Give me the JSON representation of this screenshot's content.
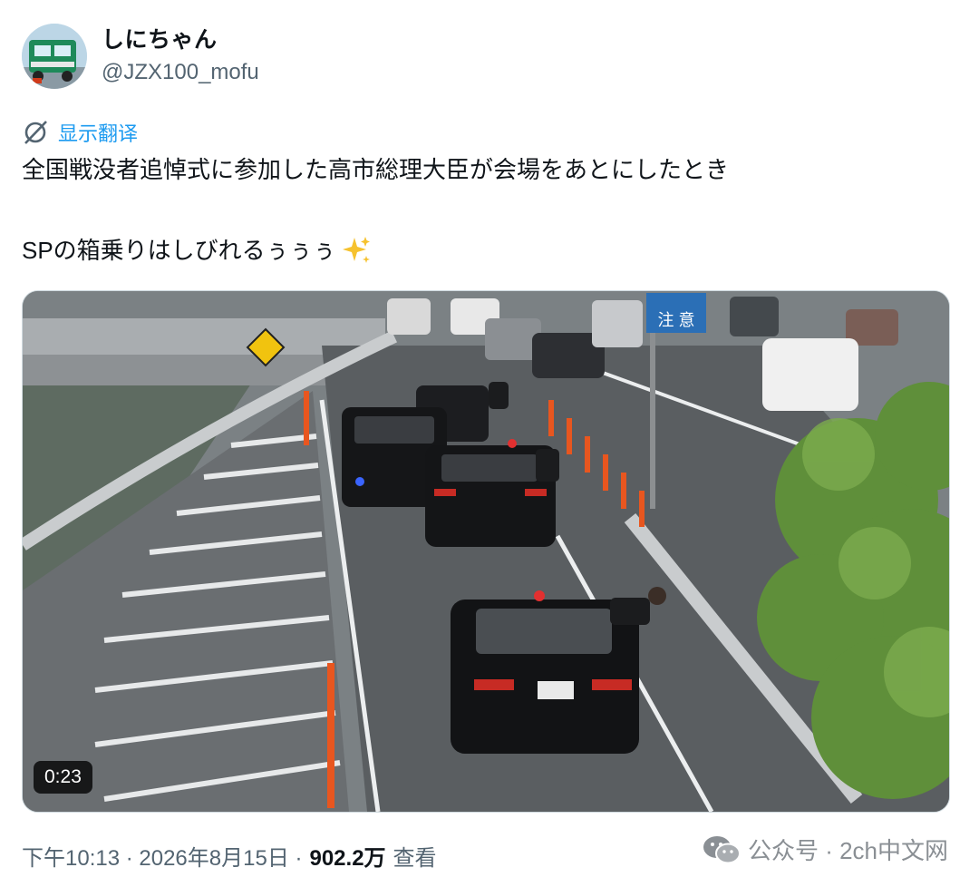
{
  "author": {
    "display_name": "しにちゃん",
    "handle": "@JZX100_mofu",
    "avatar_icon": "truck-avatar"
  },
  "translate": {
    "icon": "translate-icon",
    "label": "显示翻译"
  },
  "tweet": {
    "line1": "全国戦没者追悼式に参加した高市総理大臣が会場をあとにしたとき",
    "line2": "SPの箱乗りはしびれるぅぅぅ",
    "emoji": "sparkles-icon"
  },
  "media": {
    "duration": "0:23",
    "sign_text": "注 意"
  },
  "meta": {
    "timestamp": "下午10:13 · 2026年8月15日 ·",
    "views_count": "902.2万",
    "views_label": "查看"
  },
  "watermark": {
    "text": "公众号 · 2ch中文网",
    "icon": "wechat-icon"
  },
  "colors": {
    "link": "#1d9bf0",
    "secondary": "#536471",
    "text": "#0f1419"
  }
}
